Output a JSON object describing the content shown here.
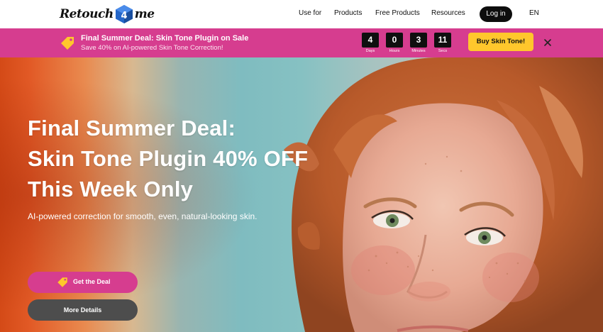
{
  "header": {
    "logo": {
      "word_left": "Retouch",
      "mark": "4",
      "word_right": "me"
    },
    "nav": [
      {
        "label": "Use for"
      },
      {
        "label": "Products"
      },
      {
        "label": "Free Products"
      },
      {
        "label": "Resources"
      }
    ],
    "login_label": "Log in",
    "language": "EN"
  },
  "promo": {
    "title": "Final Summer Deal: Skin Tone Plugin on Sale",
    "subtitle": "Save 40% on AI-powered Skin Tone Correction!",
    "countdown": [
      {
        "value": "4",
        "unit": "Days"
      },
      {
        "value": "0",
        "unit": "Hours"
      },
      {
        "value": "3",
        "unit": "Minutes"
      },
      {
        "value": "11",
        "unit": "Secs"
      }
    ],
    "buy_label": "Buy Skin Tone!",
    "icon": "price-tag-icon",
    "close_icon": "close-icon"
  },
  "hero": {
    "headline": [
      "Final Summer Deal:",
      "Skin Tone Plugin 40% OFF",
      "This Week Only"
    ],
    "subtext": "AI-powered correction for smooth, even, natural-looking skin.",
    "primary_button": "Get the Deal",
    "secondary_button": "More Details"
  },
  "colors": {
    "brand_pink": "#d63d8f",
    "accent_yellow": "#ffc72c",
    "dark": "#0d0d0d",
    "logo_blue": "#2466c9"
  }
}
